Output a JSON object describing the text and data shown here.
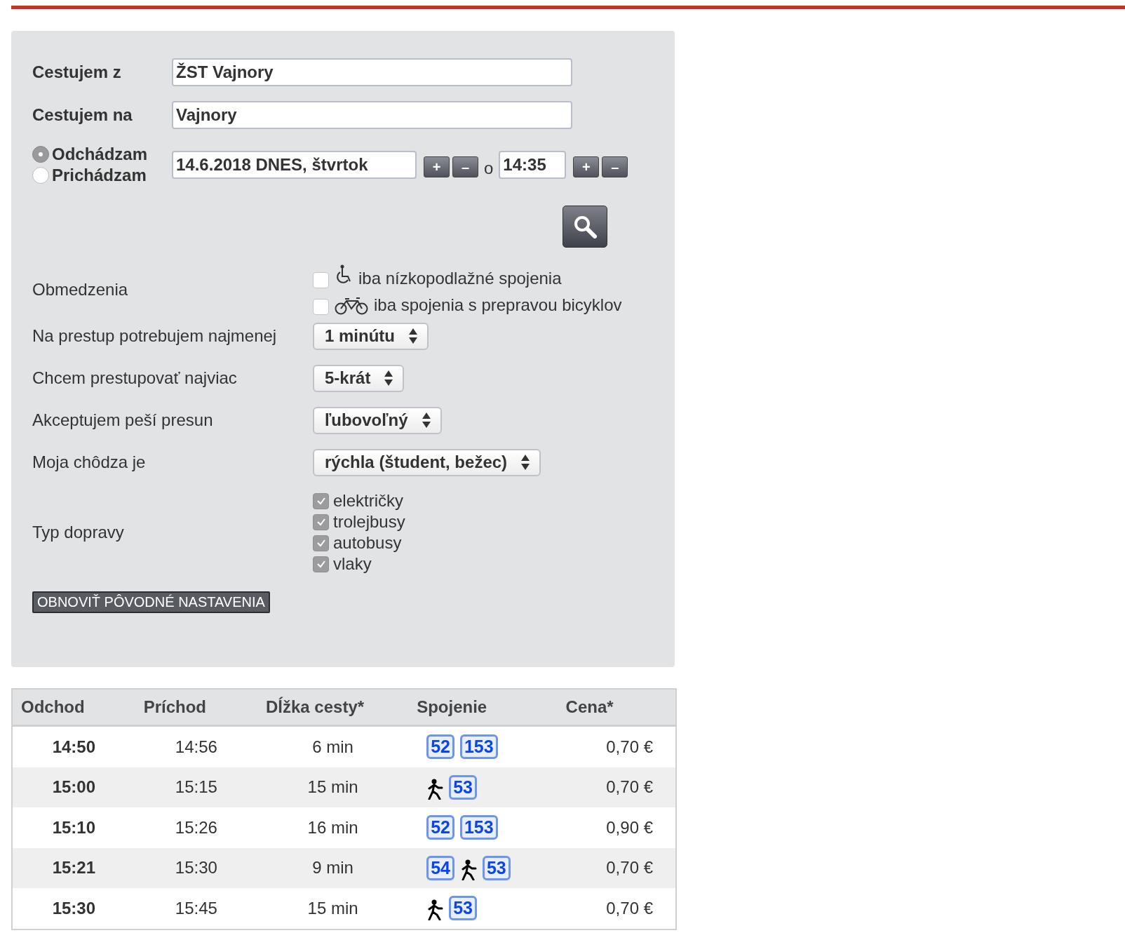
{
  "search_form": {
    "from": {
      "label": "Cestujem z",
      "value": "ŽST Vajnory"
    },
    "to": {
      "label": "Cestujem na",
      "value": "Vajnory"
    },
    "modes": [
      {
        "label": "Odchádzam",
        "selected": true
      },
      {
        "label": "Prichádzam",
        "selected": false
      }
    ],
    "date": {
      "value": "14.6.2018 DNES, štvrtok",
      "plus": "+",
      "minus": "–"
    },
    "time_separator": "o",
    "time": {
      "value": "14:35",
      "plus": "+",
      "minus": "–"
    },
    "restrictions": {
      "label": "Obmedzenia",
      "options": [
        {
          "kind": "wheelchair",
          "label": "iba nízkopodlažné spojenia",
          "checked": false
        },
        {
          "kind": "bicycle",
          "label": "iba spojenia s prepravou bicyklov",
          "checked": false
        }
      ]
    },
    "selects": [
      {
        "label": "Na prestup potrebujem najmenej",
        "value": "1 minútu"
      },
      {
        "label": "Chcem prestupovať najviac",
        "value": "5-krát"
      },
      {
        "label": "Akceptujem peší presun",
        "value": "ľubovoľný"
      },
      {
        "label": "Moja chôdza je",
        "value": "rýchla (študent, bežec)"
      }
    ],
    "transport": {
      "label": "Typ dopravy",
      "options": [
        {
          "label": "električky",
          "checked": true
        },
        {
          "label": "trolejbusy",
          "checked": true
        },
        {
          "label": "autobusy",
          "checked": true
        },
        {
          "label": "vlaky",
          "checked": true
        }
      ]
    },
    "reset_button": "OBNOVIŤ PÔVODNÉ NASTAVENIA"
  },
  "results": {
    "columns": [
      "Odchod",
      "Príchod",
      "Dĺžka cesty*",
      "Spojenie",
      "Cena*"
    ],
    "rows": [
      {
        "departure": "14:50",
        "arrival": "14:56",
        "duration": "6 min",
        "connection": [
          {
            "kind": "line",
            "text": "52"
          },
          {
            "kind": "line",
            "text": "153"
          }
        ],
        "price": "0,70 €"
      },
      {
        "departure": "15:00",
        "arrival": "15:15",
        "duration": "15 min",
        "connection": [
          {
            "kind": "walk"
          },
          {
            "kind": "line",
            "text": "53"
          }
        ],
        "price": "0,70 €"
      },
      {
        "departure": "15:10",
        "arrival": "15:26",
        "duration": "16 min",
        "connection": [
          {
            "kind": "line",
            "text": "52"
          },
          {
            "kind": "line",
            "text": "153"
          }
        ],
        "price": "0,90 €"
      },
      {
        "departure": "15:21",
        "arrival": "15:30",
        "duration": "9 min",
        "connection": [
          {
            "kind": "line",
            "text": "54"
          },
          {
            "kind": "walk"
          },
          {
            "kind": "line",
            "text": "53"
          }
        ],
        "price": "0,70 €"
      },
      {
        "departure": "15:30",
        "arrival": "15:45",
        "duration": "15 min",
        "connection": [
          {
            "kind": "walk"
          },
          {
            "kind": "line",
            "text": "53"
          }
        ],
        "price": "0,70 €"
      }
    ]
  }
}
